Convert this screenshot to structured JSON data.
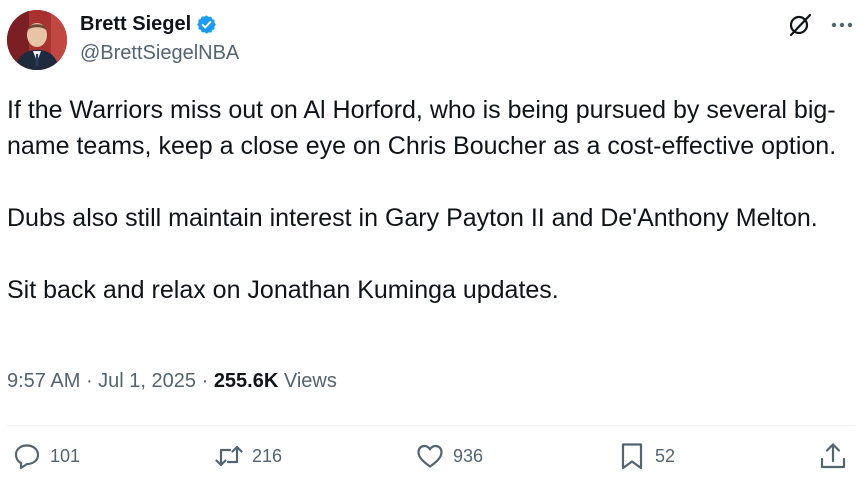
{
  "author": {
    "name": "Brett Siegel",
    "handle": "@BrettSiegelNBA",
    "verified_color": "#1d9bf0"
  },
  "tweet": {
    "paragraphs": [
      "If the Warriors miss out on Al Horford, who is being pursued by several big-name teams, keep a close eye on Chris Boucher as a cost-effective option.",
      "Dubs also still maintain interest in Gary Payton II and De'Anthony Melton.",
      "Sit back and relax on Jonathan Kuminga updates."
    ],
    "time": "9:57 AM",
    "date": "Jul 1, 2025",
    "views_count": "255.6K",
    "views_label": "Views"
  },
  "actions": {
    "replies": "101",
    "reposts": "216",
    "likes": "936",
    "bookmarks": "52"
  },
  "icons": {
    "top": [
      "grok-icon",
      "more-icon"
    ],
    "actions": [
      "reply-icon",
      "repost-icon",
      "like-icon",
      "bookmark-icon",
      "share-icon"
    ]
  }
}
